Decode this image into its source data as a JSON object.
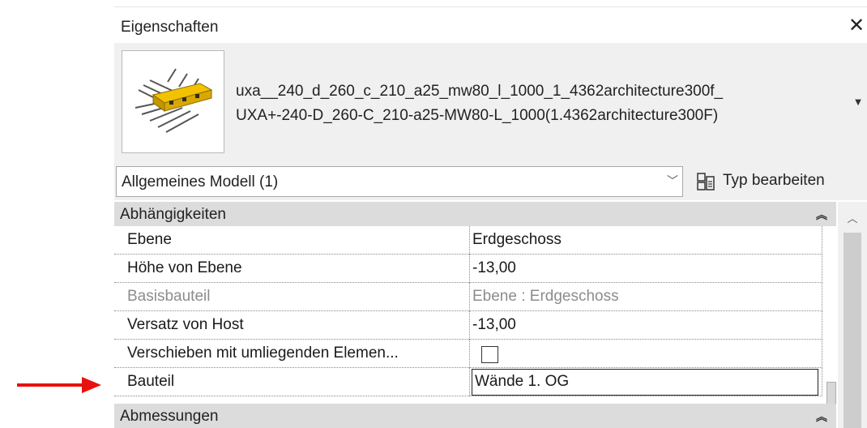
{
  "panel": {
    "title": "Eigenschaften",
    "close_icon": "close-icon"
  },
  "type_selector": {
    "name_line1": "uxa__240_d_260_c_210_a25_mw80_l_1000_1_4362architecture300f_",
    "name_line2": "UXA+-240-D_260-C_210-a25-MW80-L_1000(1.4362architecture300F)",
    "thumbnail_icon": "anchor-rail-family-icon",
    "dropdown_icon": "triangle-down-icon"
  },
  "filter": {
    "selected": "Allgemeines Modell (1)",
    "chevron_icon": "chevron-down-icon",
    "edit_type_label": "Typ bearbeiten",
    "edit_type_icon": "edit-type-icon"
  },
  "groups": {
    "constraints": {
      "label": "Abhängigkeiten",
      "toggle_icon": "collapse-double-chevron-icon"
    },
    "dimensions": {
      "label": "Abmessungen",
      "toggle_icon": "collapse-double-chevron-icon"
    }
  },
  "properties": [
    {
      "name": "Ebene",
      "value": "Erdgeschoss",
      "readonly": false
    },
    {
      "name": "Höhe von Ebene",
      "value": "-13,00",
      "readonly": false
    },
    {
      "name": "Basisbauteil",
      "value": "Ebene : Erdgeschoss",
      "readonly": true
    },
    {
      "name": "Versatz von Host",
      "value": "-13,00",
      "readonly": false
    },
    {
      "name": "Verschieben mit umliegenden Elemen...",
      "value": false,
      "readonly": false
    },
    {
      "name": "Bauteil",
      "value": "Wände 1. OG",
      "readonly": false
    }
  ],
  "colors": {
    "annotation_arrow": "#e8110f",
    "thumbnail_accent": "#f2c200"
  }
}
